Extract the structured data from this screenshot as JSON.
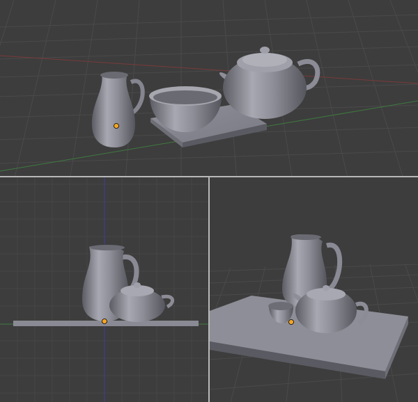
{
  "viewports": [
    {
      "id": "top",
      "view": "perspective-top"
    },
    {
      "id": "front",
      "view": "front-orthographic"
    },
    {
      "id": "persp",
      "view": "user-perspective"
    }
  ],
  "scene_objects": [
    "pitcher",
    "bowl",
    "teapot",
    "tray",
    "cup"
  ],
  "colors": {
    "background": "#3d3d3d",
    "grid": "#4a4a4a",
    "axis_x": "#7a3a3a",
    "axis_y": "#3f7a3f",
    "axis_z": "#3e3e8c",
    "object_fill": "#9a9aa3",
    "object_shade": "#5f5f68",
    "origin": "#f5a623"
  }
}
